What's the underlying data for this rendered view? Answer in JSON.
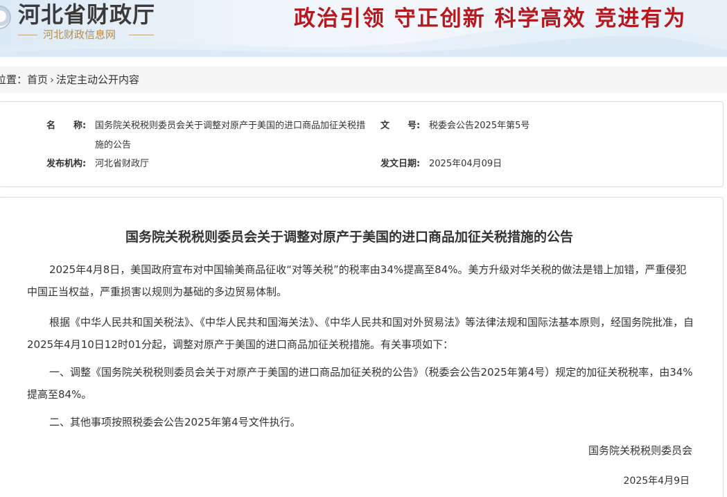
{
  "header": {
    "site_name": "河北省财政厅",
    "site_subtitle": "河北财政信息网",
    "slogan": "政治引领  守正创新  科学高效  竞进有为",
    "accent_color": "#b5181e",
    "logo_icon": "emblem-icon"
  },
  "breadcrumb": {
    "prefix": "位置：",
    "home": "首页",
    "separator": "›",
    "current": "法定主动公开内容"
  },
  "info": {
    "name_label": "名　　称:",
    "name_value": "国务院关税税则委员会关于调整对原产于美国的进口商品加征关税措施的公告",
    "doc_no_label": "文　　号:",
    "doc_no_value": "税委会公告2025年第5号",
    "issuer_label": "发布机构:",
    "issuer_value": "河北省财政厅",
    "date_label": "发文日期:",
    "date_value": "2025年04月09日"
  },
  "article": {
    "title": "国务院关税税则委员会关于调整对原产于美国的进口商品加征关税措施的公告",
    "paragraphs": [
      "2025年4月8日，美国政府宣布对中国输美商品征收“对等关税”的税率由34%提高至84%。美方升级对华关税的做法是错上加错，严重侵犯中国正当权益，严重损害以规则为基础的多边贸易体制。",
      "根据《中华人民共和国关税法》、《中华人民共和国海关法》、《中华人民共和国对外贸易法》等法律法规和国际法基本原则，经国务院批准，自2025年4月10日12时01分起，调整对原产于美国的进口商品加征关税措施。有关事项如下：",
      "一、调整《国务院关税税则委员会关于对原产于美国的进口商品加征关税的公告》（税委会公告2025年第4号）规定的加征关税税率，由34%提高至84%。",
      "二、其他事项按照税委会公告2025年第4号文件执行。"
    ],
    "signer": "国务院关税税则委员会",
    "sign_date": "2025年4月9日"
  }
}
